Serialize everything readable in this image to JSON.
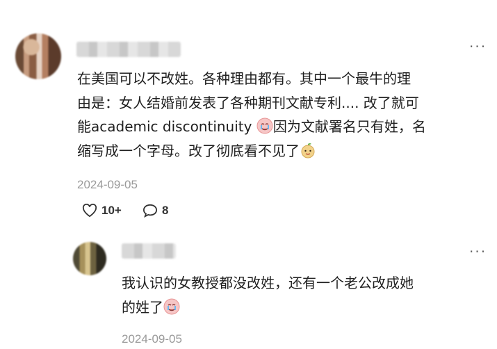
{
  "comment": {
    "body": {
      "line1": "在美国可以不改姓。各种理由都有。其中一个最牛的理",
      "line2": "由是：女人结婚前发表了各种期刊文献专利.... 改了就可",
      "line3a": "能academic discontinuity ",
      "line3b": "因为文献署名只有姓，名",
      "line4": "缩写成一个字母。改了彻底看不见了"
    },
    "date": "2024-09-05",
    "likes": "10+",
    "replies": "8"
  },
  "reply": {
    "body": {
      "line1": "我认识的女教授都没改姓，还有一个老公改成她",
      "line2": "的姓了"
    },
    "date": "2024-09-05"
  }
}
